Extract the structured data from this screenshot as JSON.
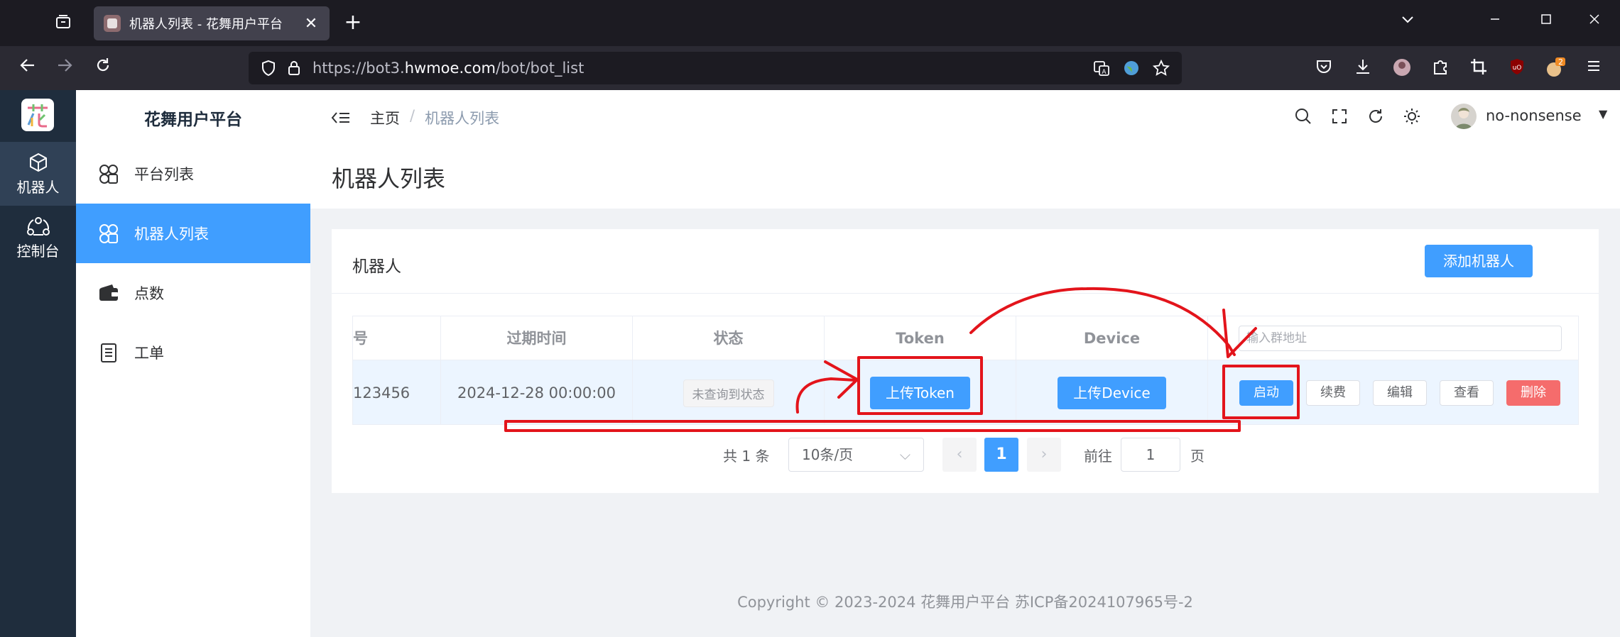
{
  "browser": {
    "tab_title": "机器人列表 - 花舞用户平台",
    "url_prefix": "https://bot3.",
    "url_domain": "hwmoe.com",
    "url_path": "/bot/bot_list",
    "extension_badge": "2"
  },
  "app": {
    "logo_text": "花",
    "rail": [
      {
        "label": "机器人",
        "icon": "cube-icon",
        "active": true
      },
      {
        "label": "控制台",
        "icon": "console-icon",
        "active": false
      }
    ],
    "sidebar_title": "花舞用户平台",
    "sidebar": [
      {
        "label": "平台列表",
        "icon": "circles-icon",
        "active": false
      },
      {
        "label": "机器人列表",
        "icon": "circles-icon",
        "active": true
      },
      {
        "label": "点数",
        "icon": "wallet-icon",
        "active": false
      },
      {
        "label": "工单",
        "icon": "document-icon",
        "active": false
      }
    ]
  },
  "header": {
    "breadcrumb_home": "主页",
    "breadcrumb_sep": "/",
    "breadcrumb_current": "机器人列表",
    "username": "no-nonsense",
    "user_caret": "▼",
    "page_title": "机器人列表"
  },
  "card": {
    "title": "机器人",
    "add_button": "添加机器人"
  },
  "table": {
    "columns": [
      "号",
      "过期时间",
      "状态",
      "Token",
      "Device"
    ],
    "group_input_placeholder": "输入群地址",
    "row": {
      "id_fragment": "123456",
      "expire": "2024-12-28 00:00:00",
      "status": "未查询到状态",
      "token_button": "上传Token",
      "device_button": "上传Device",
      "actions": [
        "启动",
        "续费",
        "编辑",
        "查看",
        "删除"
      ]
    }
  },
  "pagination": {
    "total": "共 1 条",
    "page_size": "10条/页",
    "size_caret": "⌵",
    "prev": "‹",
    "current": "1",
    "next": "›",
    "goto_label": "前往",
    "goto_value": "1",
    "goto_unit": "页"
  },
  "footer": {
    "copyright": "Copyright © 2023-2024  花舞用户平台  苏ICP备2024107965号-2"
  },
  "colors": {
    "primary": "#409eff",
    "danger": "#f56c6c",
    "annotation": "#e3141b",
    "rail_bg": "#1f2d3d"
  }
}
